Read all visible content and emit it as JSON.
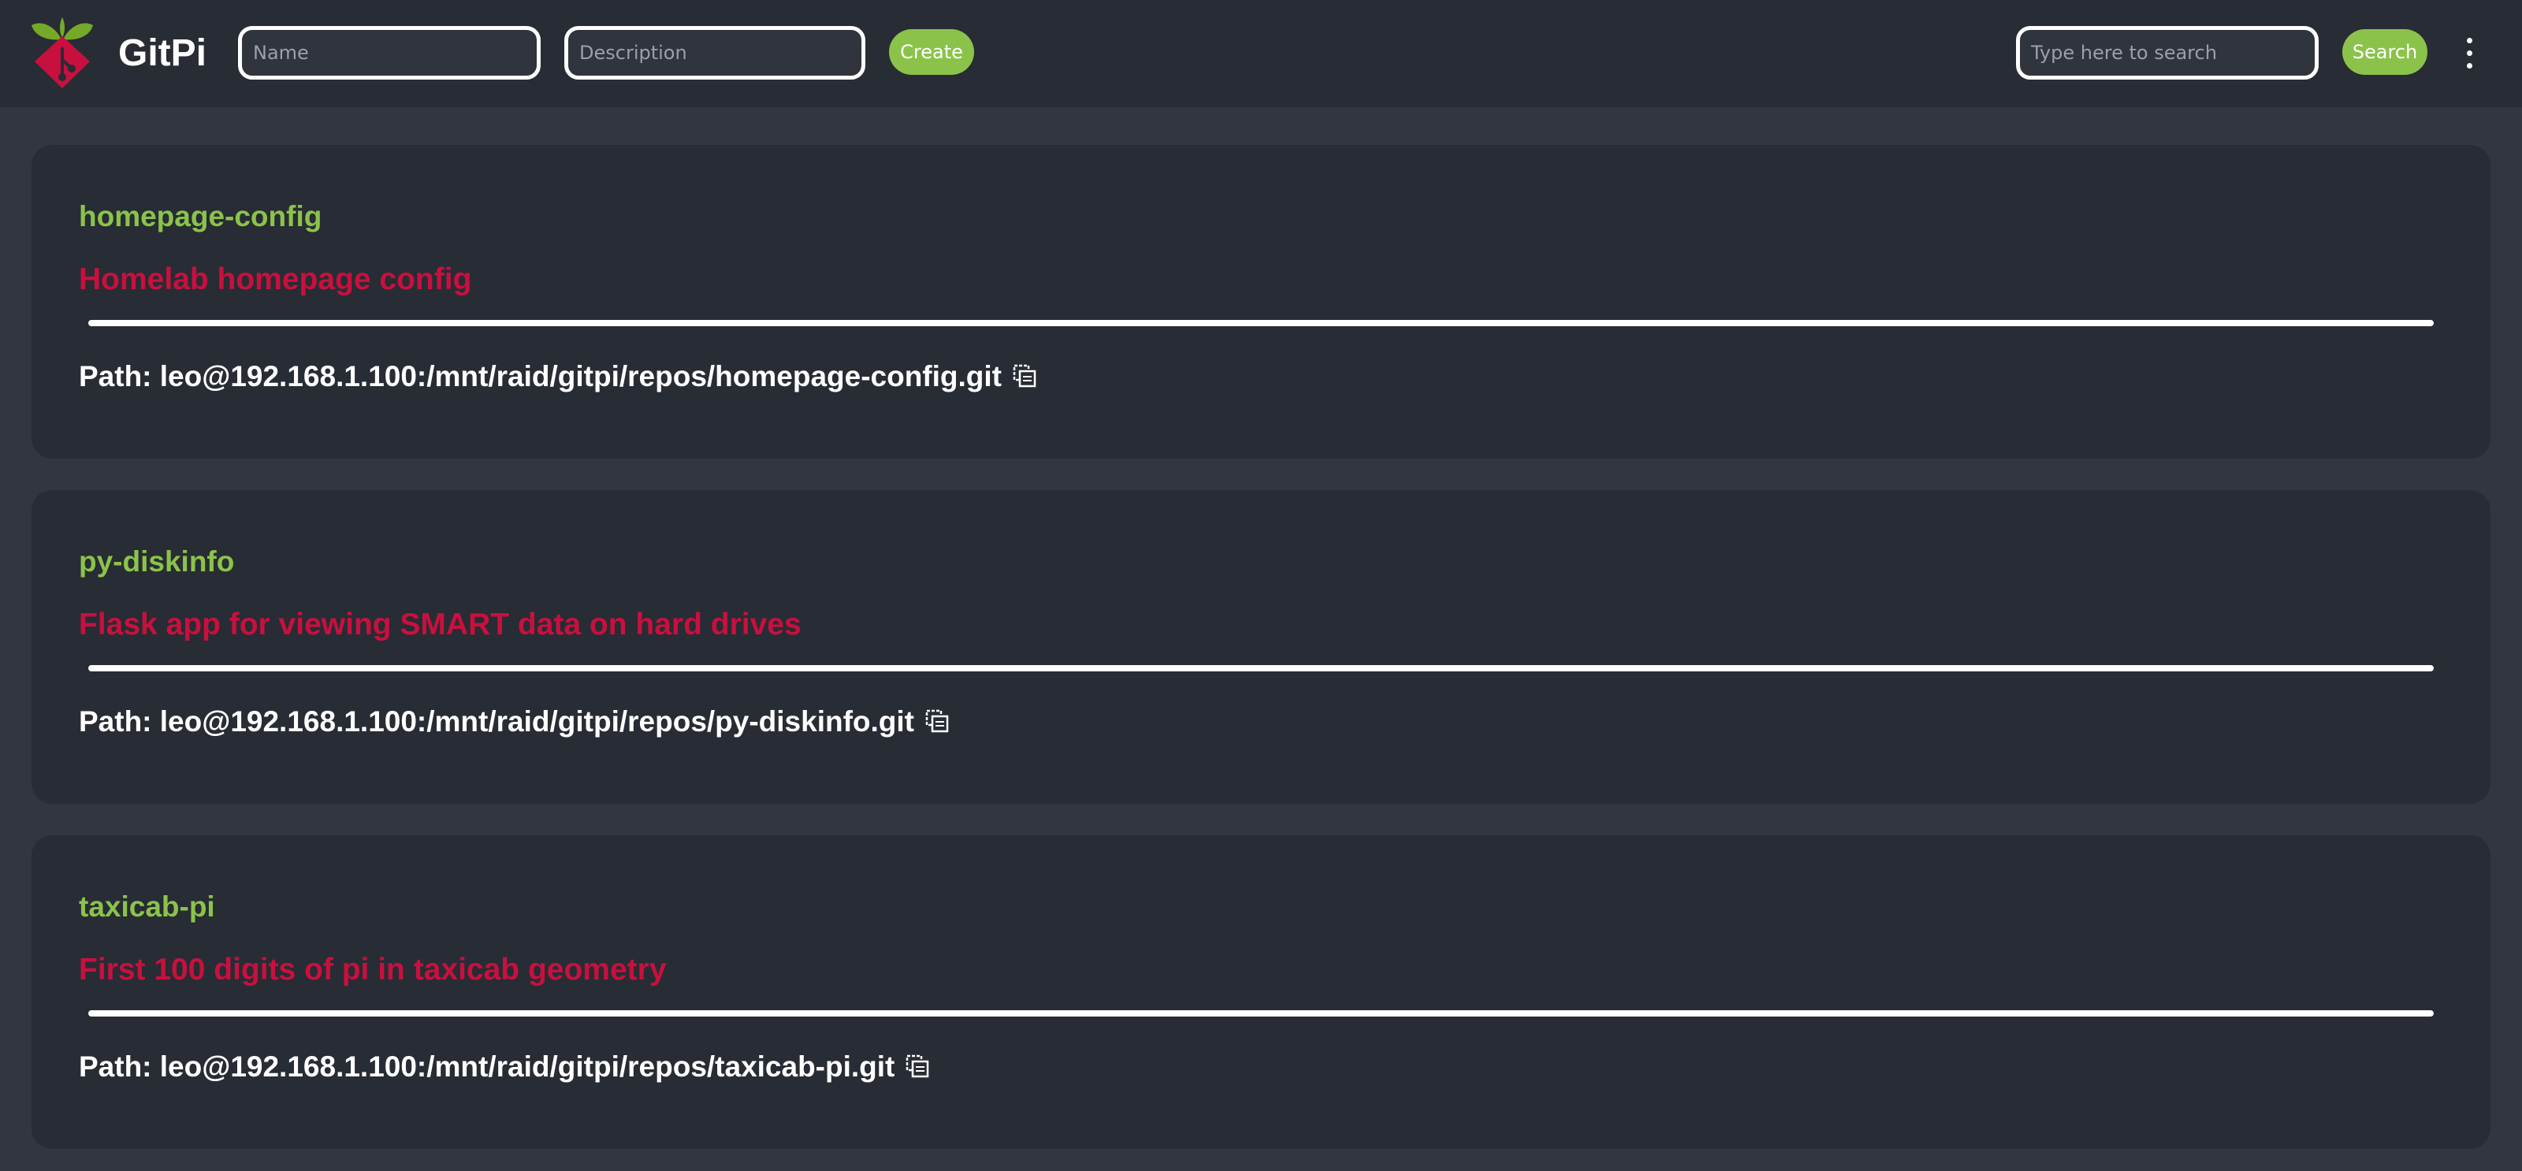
{
  "app": {
    "title": "GitPi"
  },
  "header": {
    "name_placeholder": "Name",
    "description_placeholder": "Description",
    "create_label": "Create",
    "search_placeholder": "Type here to search",
    "search_label": "Search",
    "menu_icon": "kebab-menu-icon",
    "logo_icon": "raspberry-git-logo-icon"
  },
  "colors": {
    "accent_green": "#8bc34a",
    "description_red": "#c8103e",
    "background": "#313640",
    "surface": "#282c34"
  },
  "repos": [
    {
      "name": "homepage-config",
      "description": "Homelab homepage config",
      "path": "Path: leo@192.168.1.100:/mnt/raid/gitpi/repos/homepage-config.git",
      "copy_icon": "copy-icon"
    },
    {
      "name": "py-diskinfo",
      "description": "Flask app for viewing SMART data on hard drives",
      "path": "Path: leo@192.168.1.100:/mnt/raid/gitpi/repos/py-diskinfo.git",
      "copy_icon": "copy-icon"
    },
    {
      "name": "taxicab-pi",
      "description": "First 100 digits of pi in taxicab geometry",
      "path": "Path: leo@192.168.1.100:/mnt/raid/gitpi/repos/taxicab-pi.git",
      "copy_icon": "copy-icon"
    }
  ]
}
